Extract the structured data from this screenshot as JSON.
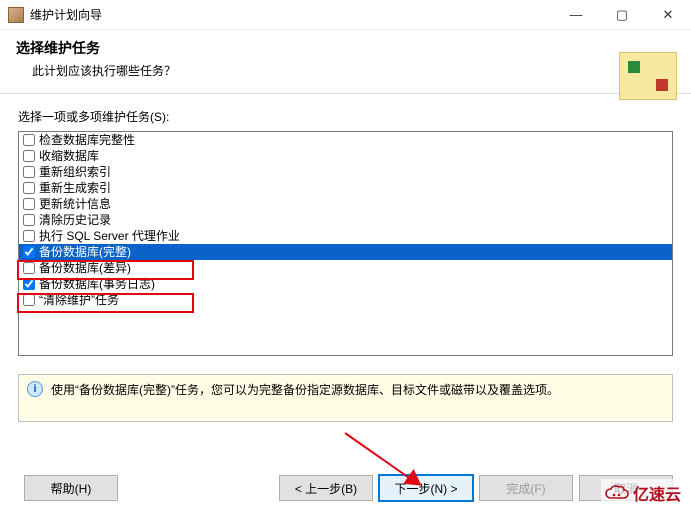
{
  "window": {
    "title": "维护计划向导",
    "minimize": "—",
    "maximize": "▢",
    "close": "✕"
  },
  "header": {
    "title": "选择维护任务",
    "subtitle": "此计划应该执行哪些任务？"
  },
  "list": {
    "label": "选择一项或多项维护任务(S):",
    "items": [
      {
        "label": "检查数据库完整性",
        "checked": false,
        "selected": false
      },
      {
        "label": "收缩数据库",
        "checked": false,
        "selected": false
      },
      {
        "label": "重新组织索引",
        "checked": false,
        "selected": false
      },
      {
        "label": "重新生成索引",
        "checked": false,
        "selected": false
      },
      {
        "label": "更新统计信息",
        "checked": false,
        "selected": false
      },
      {
        "label": "清除历史记录",
        "checked": false,
        "selected": false
      },
      {
        "label": "执行 SQL Server 代理作业",
        "checked": false,
        "selected": false
      },
      {
        "label": "备份数据库(完整)",
        "checked": true,
        "selected": true
      },
      {
        "label": "备份数据库(差异)",
        "checked": false,
        "selected": false
      },
      {
        "label": "备份数据库(事务日志)",
        "checked": true,
        "selected": false
      },
      {
        "label": "“清除维护”任务",
        "checked": false,
        "selected": false
      }
    ]
  },
  "info": {
    "text": "使用“备份数据库(完整)”任务，您可以为完整备份指定源数据库、目标文件或磁带以及覆盖选项。"
  },
  "buttons": {
    "help": "帮助(H)",
    "back": "< 上一步(B)",
    "next": "下一步(N) >",
    "finish": "完成(F)",
    "cancel": "取消"
  },
  "watermark": "亿速云"
}
